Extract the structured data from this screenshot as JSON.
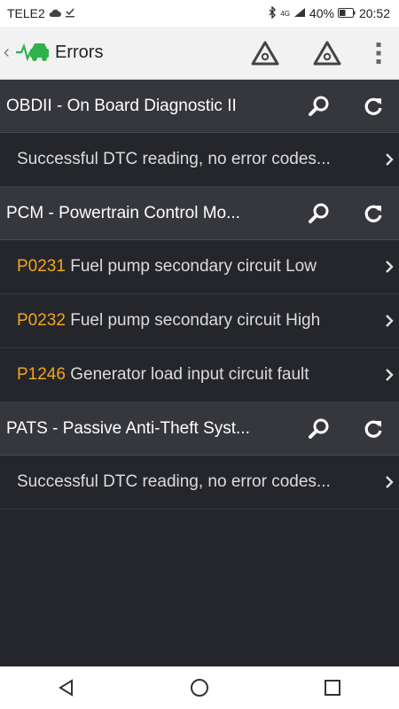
{
  "status_bar": {
    "carrier": "TELE2",
    "network_label": "4G",
    "battery": "40%",
    "time": "20:52"
  },
  "app_bar": {
    "title": "Errors",
    "back_caret": "‹"
  },
  "sections": [
    {
      "title": "OBDII - On Board Diagnostic II",
      "items": [
        {
          "code": "",
          "text": "Successful DTC reading, no error codes..."
        }
      ]
    },
    {
      "title": "PCM - Powertrain Control Mo...",
      "items": [
        {
          "code": "P0231",
          "text": " Fuel pump secondary circuit Low"
        },
        {
          "code": "P0232",
          "text": " Fuel pump secondary circuit High"
        },
        {
          "code": "P1246",
          "text": " Generator load input circuit fault"
        }
      ]
    },
    {
      "title": "PATS - Passive Anti-Theft Syst...",
      "items": [
        {
          "code": "",
          "text": "Successful DTC reading, no error codes..."
        }
      ]
    }
  ],
  "colors": {
    "background": "#25262b",
    "section_background": "#36373d",
    "code_accent": "#f2a51c",
    "logo_green": "#2fb24c"
  }
}
